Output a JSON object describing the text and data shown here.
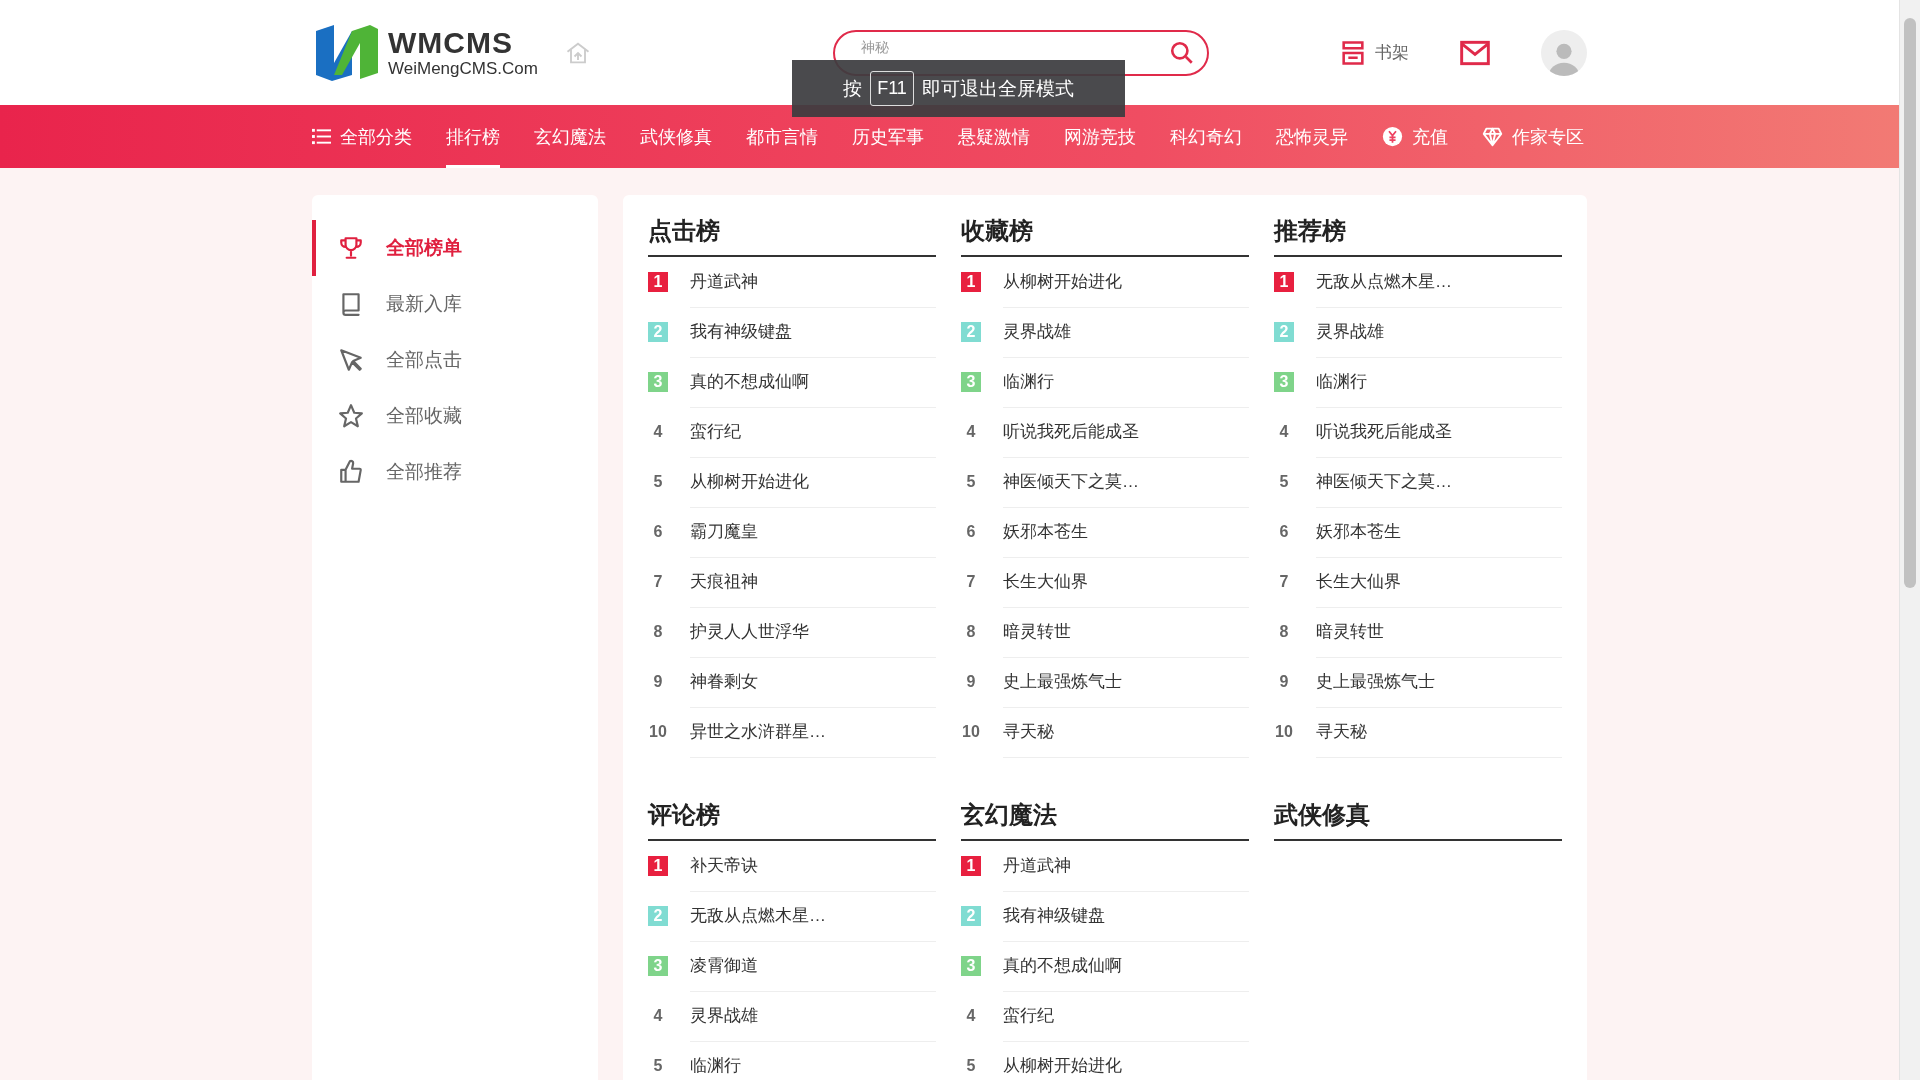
{
  "header": {
    "logo": {
      "name": "WMCMS",
      "domain": "WeiMengCMS.Com"
    },
    "search": {
      "placeholder": "神秘"
    },
    "bookshelf": "书架"
  },
  "fullscreen_notice": {
    "before": "按",
    "key": "F11",
    "after": "即可退出全屏模式"
  },
  "nav": [
    {
      "label": "全部分类",
      "kind": "menu",
      "selected": false
    },
    {
      "label": "排行榜",
      "kind": "link",
      "selected": true
    },
    {
      "label": "玄幻魔法",
      "kind": "link",
      "selected": false
    },
    {
      "label": "武侠修真",
      "kind": "link",
      "selected": false
    },
    {
      "label": "都市言情",
      "kind": "link",
      "selected": false
    },
    {
      "label": "历史军事",
      "kind": "link",
      "selected": false
    },
    {
      "label": "悬疑激情",
      "kind": "link",
      "selected": false
    },
    {
      "label": "网游竞技",
      "kind": "link",
      "selected": false
    },
    {
      "label": "科幻奇幻",
      "kind": "link",
      "selected": false
    },
    {
      "label": "恐怖灵异",
      "kind": "link",
      "selected": false
    },
    {
      "label": "充值",
      "kind": "coin",
      "selected": false
    },
    {
      "label": "作家专区",
      "kind": "diamond",
      "selected": false
    }
  ],
  "sidebar": [
    {
      "label": "全部榜单",
      "kind": "trophy",
      "selected": true
    },
    {
      "label": "最新入库",
      "kind": "book",
      "selected": false
    },
    {
      "label": "全部点击",
      "kind": "pointer",
      "selected": false
    },
    {
      "label": "全部收藏",
      "kind": "star",
      "selected": false
    },
    {
      "label": "全部推荐",
      "kind": "thumb",
      "selected": false
    }
  ],
  "sections": [
    {
      "title": "点击榜",
      "items": [
        {
          "rank": "1",
          "title": "丹道武神",
          "color": "#e8203f"
        },
        {
          "rank": "2",
          "title": "我有神级键盘",
          "color": "#80dcd2"
        },
        {
          "rank": "3",
          "title": "真的不想成仙啊",
          "color": "#7fd48a"
        },
        {
          "rank": "4",
          "title": "蛮行纪"
        },
        {
          "rank": "5",
          "title": "从柳树开始进化"
        },
        {
          "rank": "6",
          "title": "霸刀魔皇"
        },
        {
          "rank": "7",
          "title": "天痕祖神"
        },
        {
          "rank": "8",
          "title": "护灵人人世浮华"
        },
        {
          "rank": "9",
          "title": "神眷剩女"
        },
        {
          "rank": "10",
          "title": "异世之水浒群星…"
        }
      ]
    },
    {
      "title": "收藏榜",
      "items": [
        {
          "rank": "1",
          "title": "从柳树开始进化",
          "color": "#e8203f"
        },
        {
          "rank": "2",
          "title": "灵界战雄",
          "color": "#80dcd2"
        },
        {
          "rank": "3",
          "title": "临渊行",
          "color": "#7fd48a"
        },
        {
          "rank": "4",
          "title": "听说我死后能成圣"
        },
        {
          "rank": "5",
          "title": "神医倾天下之莫…"
        },
        {
          "rank": "6",
          "title": "妖邪本苍生"
        },
        {
          "rank": "7",
          "title": "长生大仙界"
        },
        {
          "rank": "8",
          "title": "暗灵转世"
        },
        {
          "rank": "9",
          "title": "史上最强炼气士"
        },
        {
          "rank": "10",
          "title": "寻天秘"
        }
      ]
    },
    {
      "title": "推荐榜",
      "items": [
        {
          "rank": "1",
          "title": "无敌从点燃木星…",
          "color": "#e8203f"
        },
        {
          "rank": "2",
          "title": "灵界战雄",
          "color": "#80dcd2"
        },
        {
          "rank": "3",
          "title": "临渊行",
          "color": "#7fd48a"
        },
        {
          "rank": "4",
          "title": "听说我死后能成圣"
        },
        {
          "rank": "5",
          "title": "神医倾天下之莫…"
        },
        {
          "rank": "6",
          "title": "妖邪本苍生"
        },
        {
          "rank": "7",
          "title": "长生大仙界"
        },
        {
          "rank": "8",
          "title": "暗灵转世"
        },
        {
          "rank": "9",
          "title": "史上最强炼气士"
        },
        {
          "rank": "10",
          "title": "寻天秘"
        }
      ]
    },
    {
      "title": "评论榜",
      "items": [
        {
          "rank": "1",
          "title": "补天帝诀",
          "color": "#e8203f"
        },
        {
          "rank": "2",
          "title": "无敌从点燃木星…",
          "color": "#80dcd2"
        },
        {
          "rank": "3",
          "title": "凌霄御道",
          "color": "#7fd48a"
        },
        {
          "rank": "4",
          "title": "灵界战雄"
        },
        {
          "rank": "5",
          "title": "临渊行"
        }
      ]
    },
    {
      "title": "玄幻魔法",
      "items": [
        {
          "rank": "1",
          "title": "丹道武神",
          "color": "#e8203f"
        },
        {
          "rank": "2",
          "title": "我有神级键盘",
          "color": "#80dcd2"
        },
        {
          "rank": "3",
          "title": "真的不想成仙啊",
          "color": "#7fd48a"
        },
        {
          "rank": "4",
          "title": "蛮行纪"
        },
        {
          "rank": "5",
          "title": "从柳树开始进化"
        }
      ]
    },
    {
      "title": "武侠修真"
    }
  ]
}
